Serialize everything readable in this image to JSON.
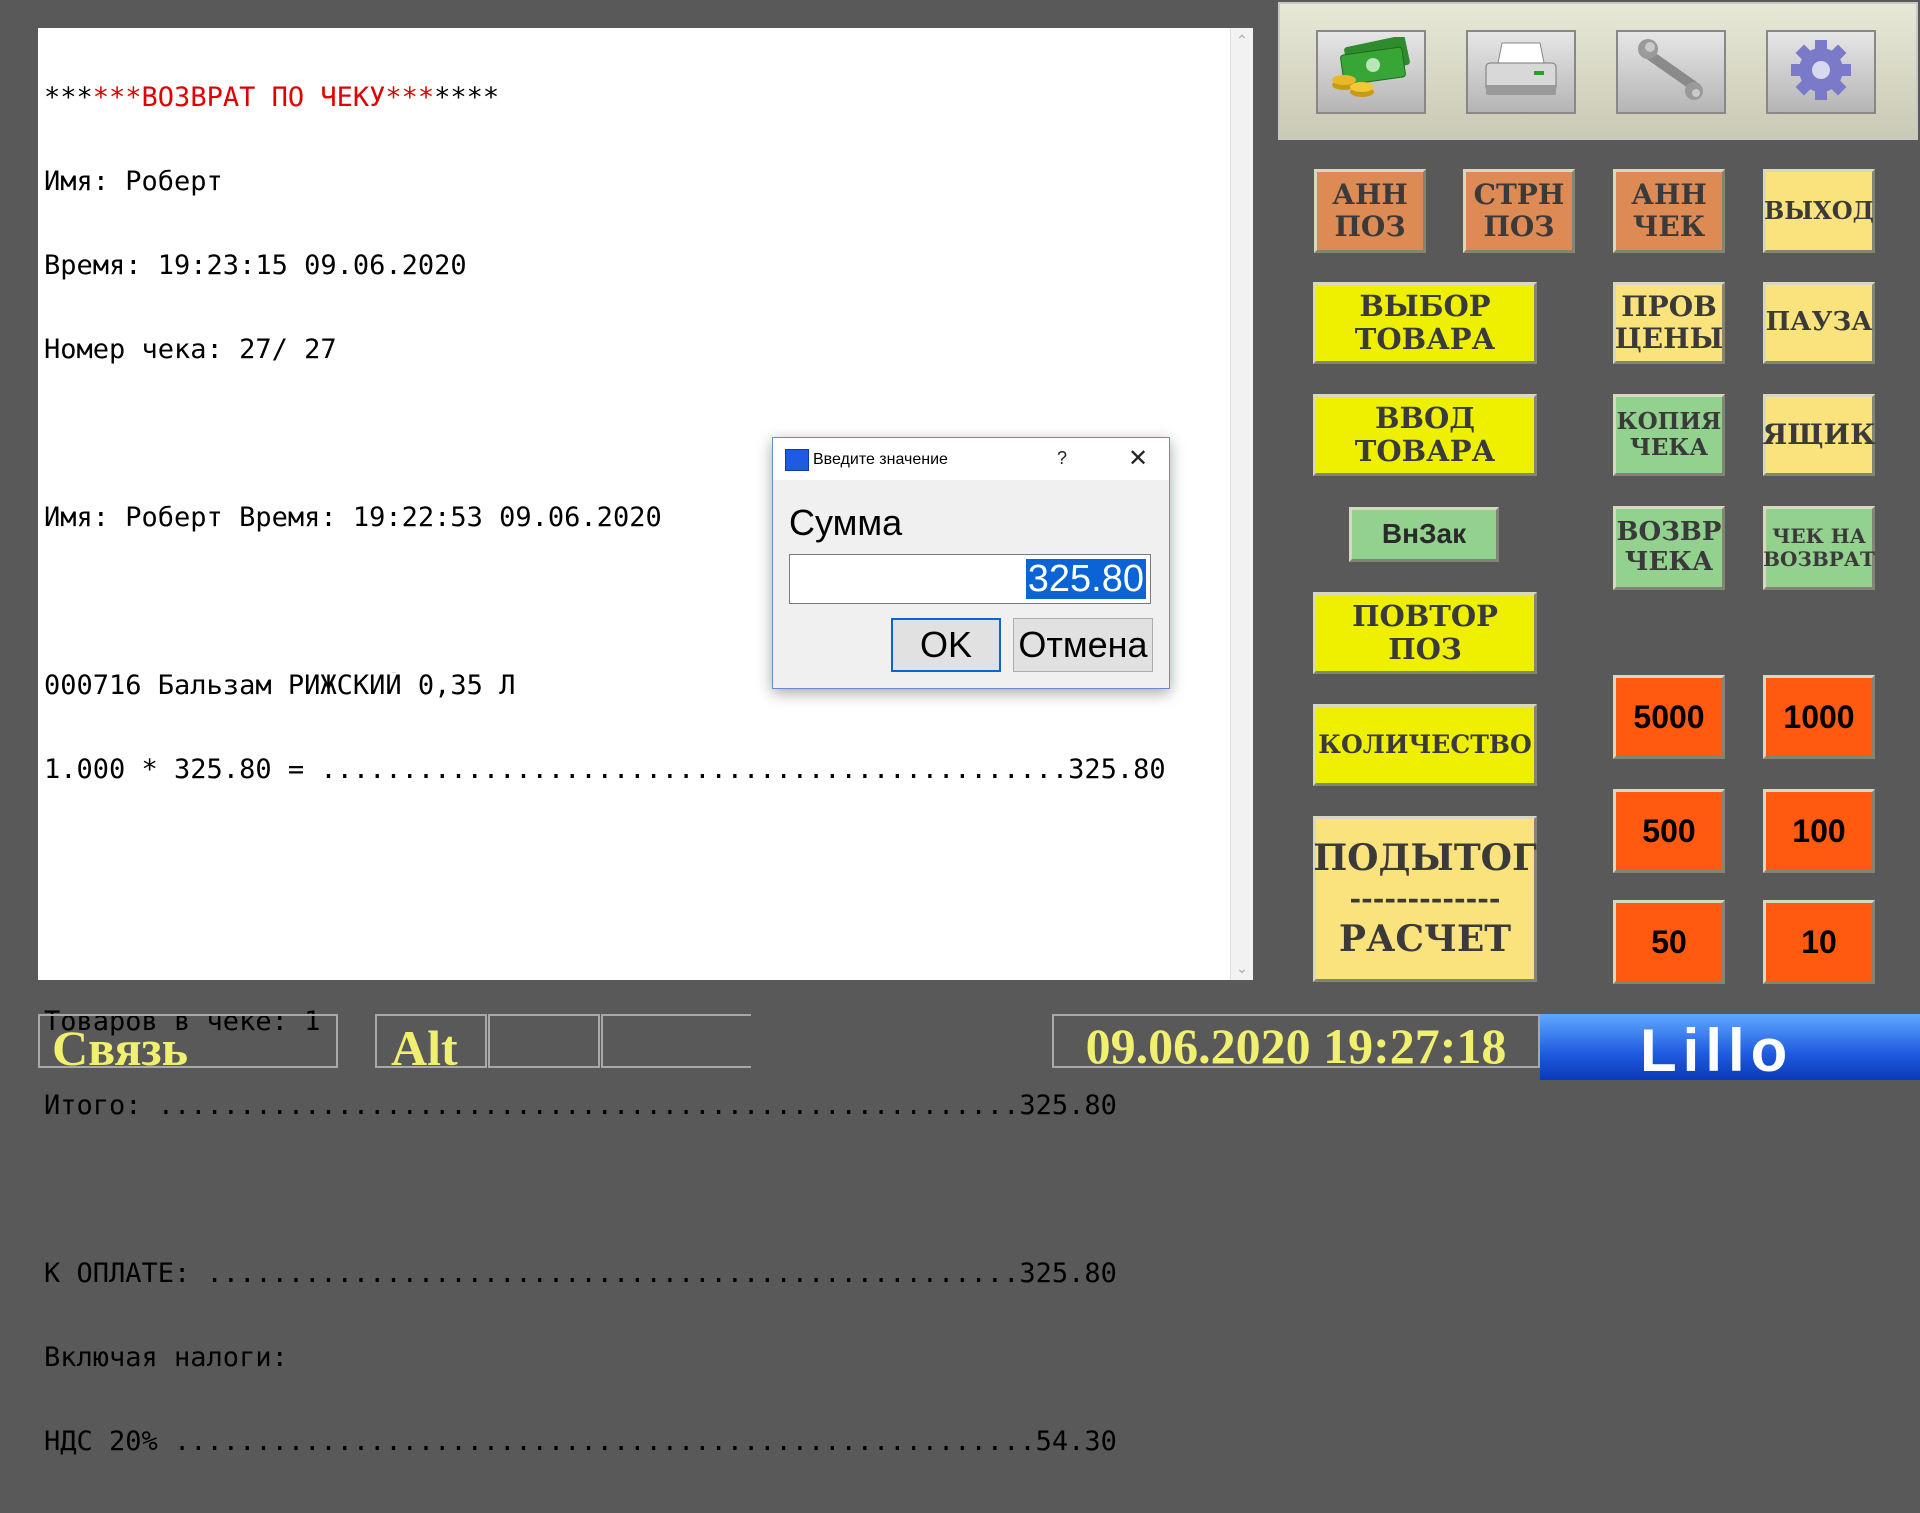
{
  "receipt": {
    "lines": [
      {
        "pre": "***",
        "red": "***ВОЗВРАТ ПО ЧЕКУ***",
        "post": "****"
      },
      {
        "text": "Имя: Роберт"
      },
      {
        "text": "Время: 19:23:15 09.06.2020"
      },
      {
        "text": "Номер чека: 27/ 27"
      },
      {
        "text": ""
      },
      {
        "text": "Имя: Роберт Время: 19:22:53 09.06.2020"
      },
      {
        "text": ""
      },
      {
        "text": "000716 Бальзам РИЖСКИЙ 0,35 Л"
      },
      {
        "text": "1.000 * 325.80 = ..............................................325.80"
      },
      {
        "text": ""
      },
      {
        "text": ""
      },
      {
        "text": "Товаров в чеке: 1"
      },
      {
        "text": "Итого: .....................................................325.80"
      },
      {
        "text": ""
      },
      {
        "text": "К ОПЛАТЕ: ..................................................325.80"
      },
      {
        "text": "Включая налоги:"
      },
      {
        "text": "НДС 20% .....................................................54.30"
      }
    ]
  },
  "toolbar": {
    "icons": [
      "money-icon",
      "printer-icon",
      "wrench-icon",
      "settings-gear-icon"
    ]
  },
  "buttons": {
    "ann_pos": "АНН\nПОЗ",
    "strn_pos": "СТРН\nПОЗ",
    "ann_check": "АНН\nЧЕК",
    "exit": "ВЫХОД",
    "select_goods": "ВЫБОР\nТОВАРА",
    "check_price": "ПРОВ\nЦЕНЫ",
    "pause": "ПАУЗА",
    "enter_goods": "ВВОД\nТОВАРА",
    "copy_check": "КОПИЯ\nЧЕКА",
    "drawer": "ЯЩИК",
    "vnzak": "ВнЗак",
    "return_check": "ВОЗВР\nЧЕКА",
    "check_for_return": "ЧЕК НА\nВОЗВРАТ",
    "repeat_pos": "ПОВТОР\nПОЗ",
    "quantity": "КОЛИЧЕСТВО",
    "subtotal": "ПОДЫТОГ",
    "subtotal_sep": "-------------",
    "payment": "РАСЧЕТ",
    "cash_5000": "5000",
    "cash_1000": "1000",
    "cash_500": "500",
    "cash_100": "100",
    "cash_50": "50",
    "cash_10": "10"
  },
  "status": {
    "connection": "Связь",
    "alt": "Alt",
    "datetime": "09.06.2020 19:27:18",
    "logo_text": "Lillo"
  },
  "dialog": {
    "title": "Введите значение",
    "help": "?",
    "label": "Сумма",
    "value": "325.80",
    "ok": "OK",
    "cancel": "Отмена"
  },
  "colors": {
    "background": "#595959",
    "status_text": "#f0ef70",
    "highlight": "#0a64d6"
  }
}
